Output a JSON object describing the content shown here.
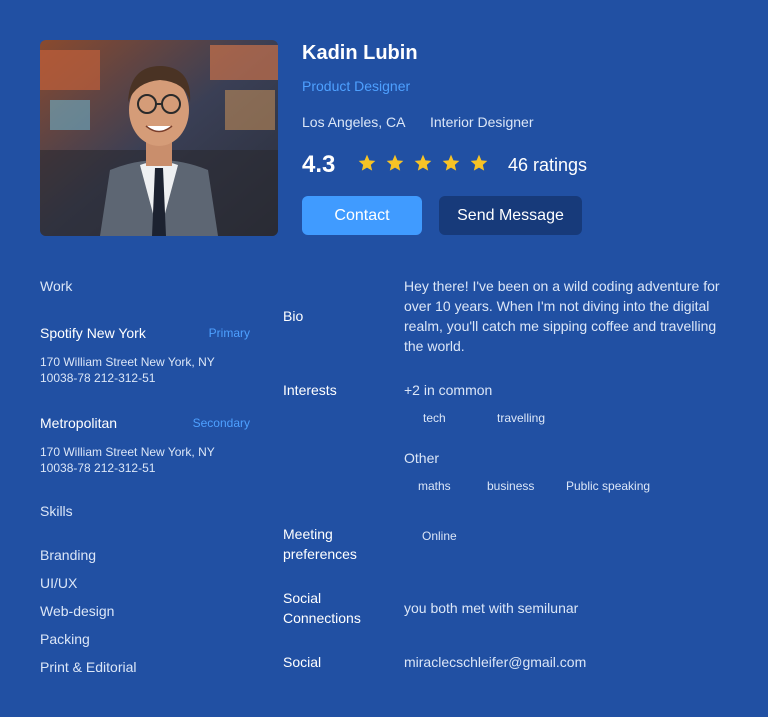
{
  "profile": {
    "name": "Kadin Lubin",
    "role": "Product Designer",
    "location": "Los Angeles, CA",
    "secondary_role": "Interior Designer",
    "rating": "4.3",
    "stars": 5,
    "ratings_count": "46 ratings",
    "star_color": "#f7c325"
  },
  "actions": {
    "contact_label": "Contact",
    "send_label": "Send Message"
  },
  "work": {
    "heading": "Work",
    "jobs": [
      {
        "company": "Spotify New York",
        "badge": "Primary",
        "address_line1": "170 William Street New York, NY",
        "address_line2": "10038-78 212-312-51"
      },
      {
        "company": "Metropolitan",
        "badge": "Secondary",
        "address_line1": "170 William Street New York, NY",
        "address_line2": "10038-78 212-312-51"
      }
    ]
  },
  "skills": {
    "heading": "Skills",
    "items": [
      "Branding",
      "UI/UX",
      "Web-design",
      "Packing",
      "Print & Editorial"
    ]
  },
  "details": {
    "bio_label": "Bio",
    "bio_text": "Hey there! I've been on a wild coding adventure for over 10 years. When I'm not diving into the digital realm, you'll catch me sipping coffee and travelling the world.",
    "interests_label": "Interests",
    "common_label": "+2 in common",
    "common_tags": [
      "tech",
      "travelling"
    ],
    "other_label": "Other",
    "other_tags": [
      "maths",
      "business",
      "Public speaking"
    ],
    "meeting_label_line1": "Meeting",
    "meeting_label_line2": "preferences",
    "meeting_value": "Online",
    "social_conn_label_line1": "Social",
    "social_conn_label_line2": "Connections",
    "social_conn_value": "you both met with semilunar",
    "social_label": "Social",
    "social_value": "miraclecschleifer@gmail.com"
  },
  "colors": {
    "background": "#2150a3",
    "accent": "#409bff",
    "secondary_button": "#173a7a"
  }
}
